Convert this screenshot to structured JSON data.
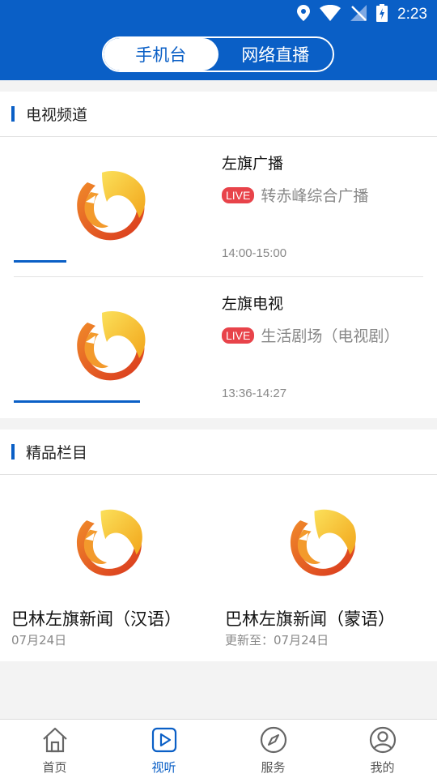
{
  "status_bar": {
    "time": "2:23",
    "icons": [
      "location-icon",
      "wifi-icon",
      "no-signal-icon",
      "battery-charging-icon"
    ]
  },
  "header": {
    "tabs": [
      {
        "label": "手机台",
        "active": true
      },
      {
        "label": "网络直播",
        "active": false
      }
    ]
  },
  "tv_section": {
    "title": "电视频道",
    "channels": [
      {
        "name": "左旗广播",
        "live_label": "LIVE",
        "program": "转赤峰综合广播",
        "time": "14:00-15:00",
        "progress": 0.27
      },
      {
        "name": "左旗电视",
        "live_label": "LIVE",
        "program": "生活剧场（电视剧）",
        "time": "13:36-14:27",
        "progress": 0.65
      }
    ]
  },
  "featured_section": {
    "title": "精品栏目",
    "items": [
      {
        "title": "巴林左旗新闻（汉语）",
        "date": "07月24日"
      },
      {
        "title": "巴林左旗新闻（蒙语）",
        "date": "更新至：07月24日"
      }
    ]
  },
  "bottom_nav": [
    {
      "label": "首页",
      "icon": "home-icon",
      "active": false
    },
    {
      "label": "视听",
      "icon": "play-icon",
      "active": true
    },
    {
      "label": "服务",
      "icon": "compass-icon",
      "active": false
    },
    {
      "label": "我的",
      "icon": "user-icon",
      "active": false
    }
  ],
  "colors": {
    "primary": "#0a5fc6",
    "live": "#e8434a",
    "logo_yellow": "#f6c416",
    "logo_orange": "#e8562a"
  }
}
